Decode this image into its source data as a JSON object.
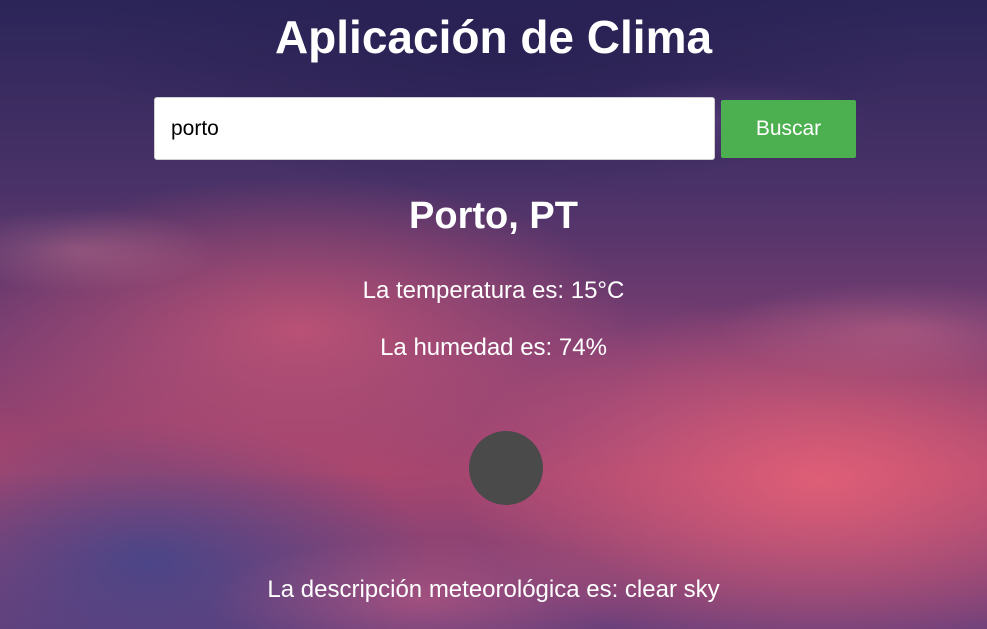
{
  "app": {
    "title": "Aplicación de Clima"
  },
  "search": {
    "value": "porto",
    "button_label": "Buscar"
  },
  "weather": {
    "city": "Porto, PT",
    "temperature_text": "La temperatura es: 15°C",
    "humidity_text": "La humedad es: 74%",
    "description_text": "La descripción meteorológica es: clear sky",
    "icon": "weather-icon-placeholder"
  },
  "colors": {
    "button_bg": "#4caf50",
    "icon_placeholder": "#4a4a4a"
  }
}
